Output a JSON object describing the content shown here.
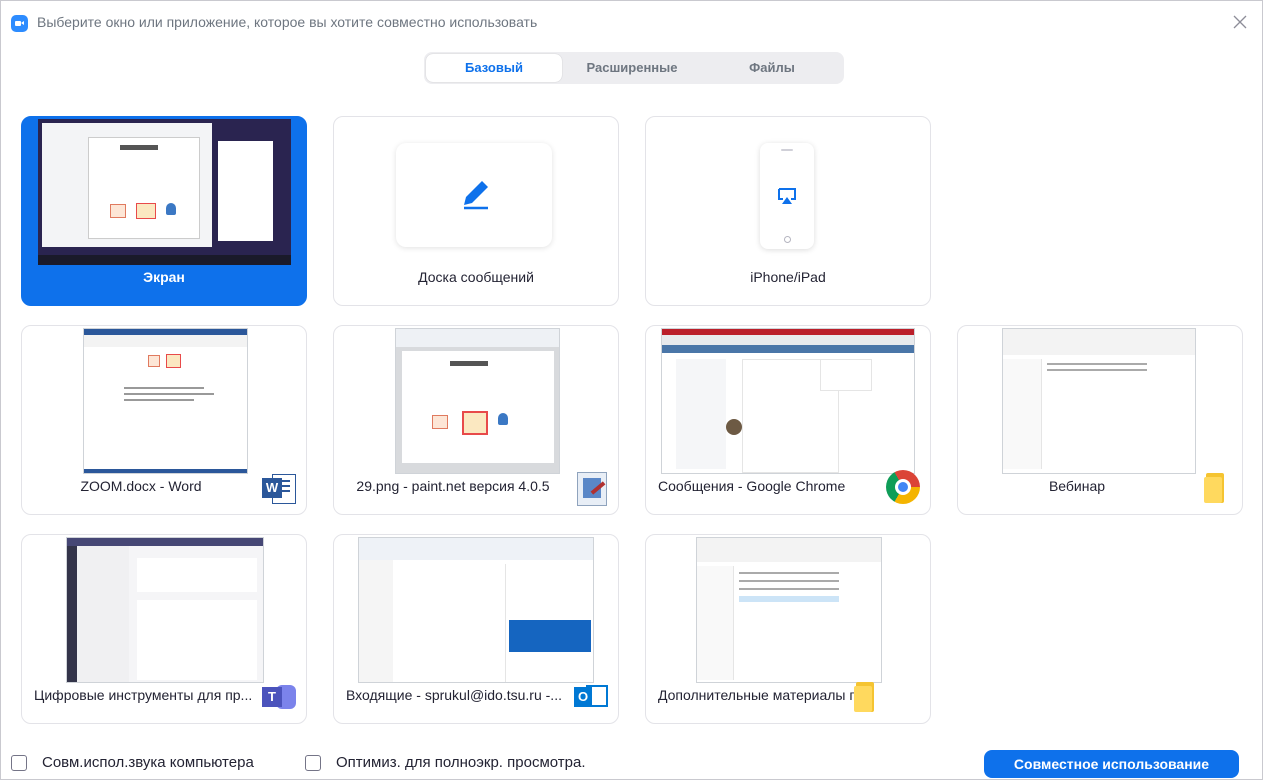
{
  "window": {
    "title": "Выберите окно или приложение, которое вы хотите совместно использовать"
  },
  "tabs": [
    {
      "label": "Базовый",
      "active": true
    },
    {
      "label": "Расширенные",
      "active": false
    },
    {
      "label": "Файлы",
      "active": false
    }
  ],
  "items": [
    {
      "label": "Экран",
      "selected": true,
      "icon": "screen-thumbnail"
    },
    {
      "label": "Доска сообщений",
      "icon": "pencil-icon"
    },
    {
      "label": "iPhone/iPad",
      "icon": "airplay-icon"
    },
    {
      "label": "ZOOM.docx - Word",
      "icon": "word-icon"
    },
    {
      "label": "29.png - paint.net версия 4.0.5",
      "icon": "paintnet-icon"
    },
    {
      "label": "Сообщения - Google Chrome",
      "icon": "chrome-icon"
    },
    {
      "label": "Вебинар",
      "icon": "folder-icon"
    },
    {
      "label": "Цифровые инструменты для пр...",
      "icon": "teams-icon"
    },
    {
      "label": "Входящие - sprukul@ido.tsu.ru -...",
      "icon": "outlook-icon"
    },
    {
      "label": "Дополнительные материалы п...",
      "icon": "folder-icon"
    }
  ],
  "footer": {
    "share_audio_label": "Совм.испол.звука компьютера",
    "optimize_label": "Оптимиз. для полноэкр. просмотра.",
    "share_button": "Совместное использование"
  },
  "colors": {
    "accent": "#0e71eb",
    "brand": "#2d8cff",
    "text": "#232333",
    "muted": "#6e7680"
  }
}
